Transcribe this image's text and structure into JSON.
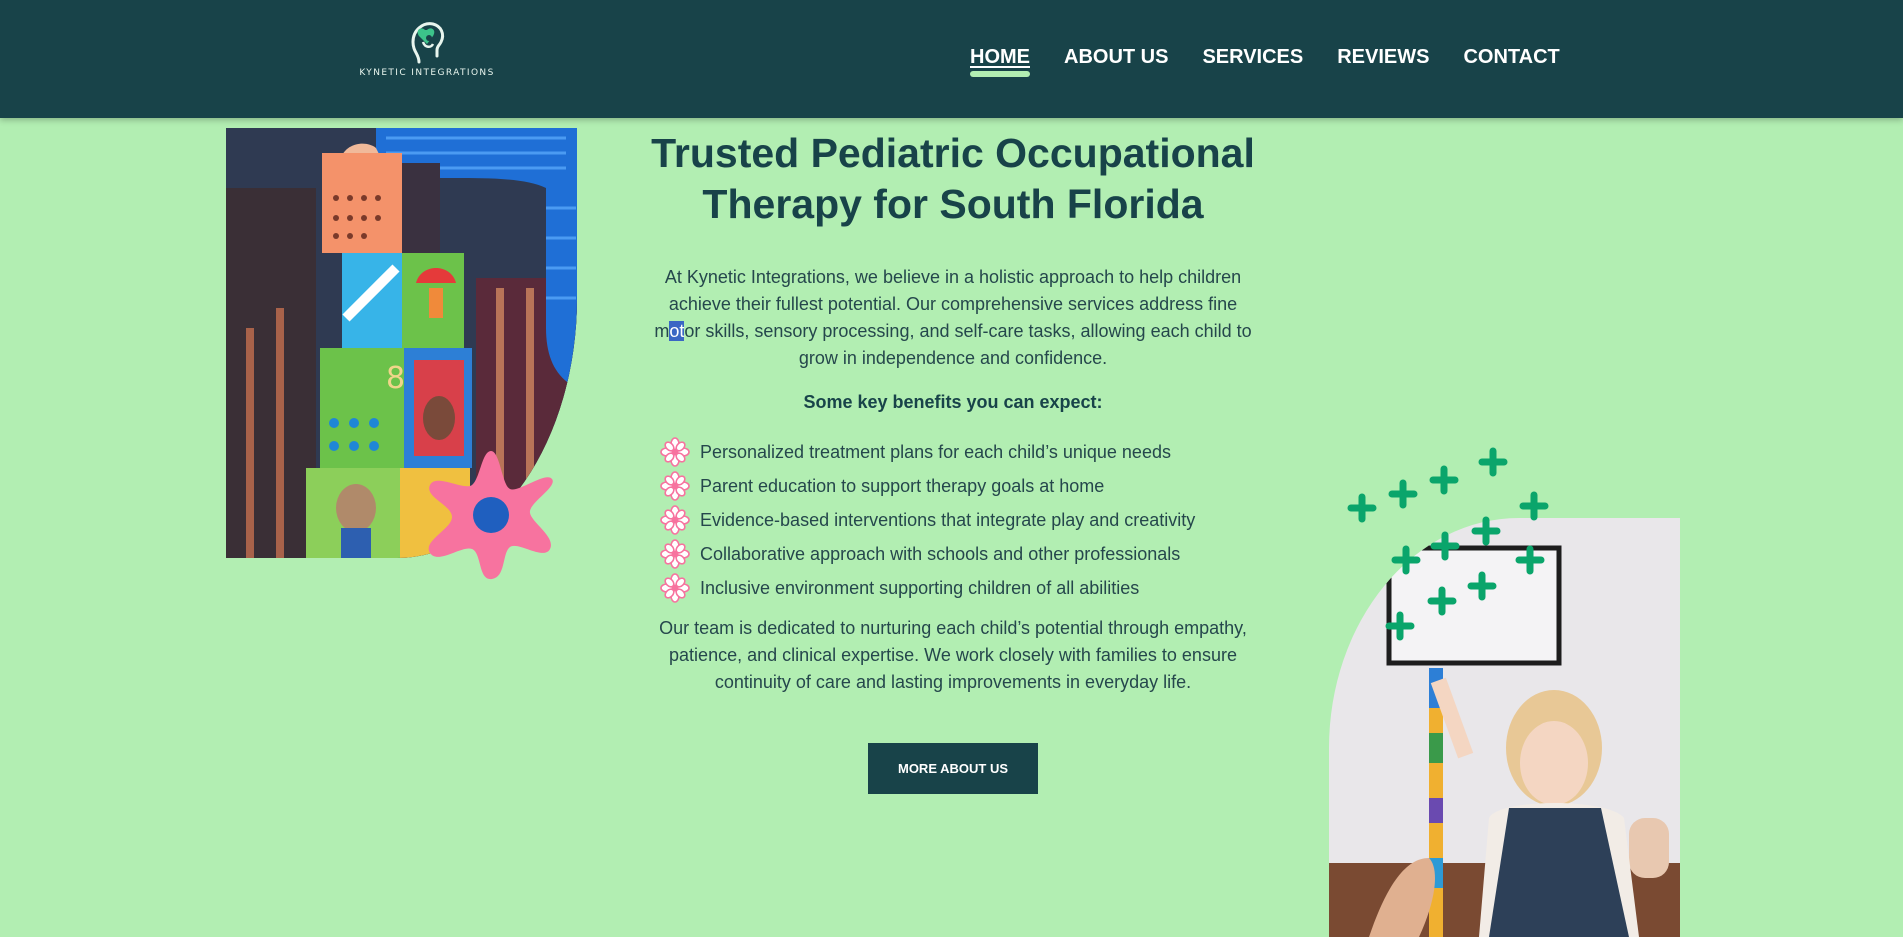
{
  "header": {
    "logo_text": "KYNETIC INTEGRATIONS",
    "nav": [
      {
        "label": "HOME",
        "active": true
      },
      {
        "label": "ABOUT US",
        "active": false
      },
      {
        "label": "SERVICES",
        "active": false
      },
      {
        "label": "REVIEWS",
        "active": false
      },
      {
        "label": "CONTACT",
        "active": false
      }
    ]
  },
  "hero": {
    "title_line1": "Trusted Pediatric Occupational",
    "title_line2": "Therapy for South Florida",
    "intro_part1": "At Kynetic Integrations, we believe in a holistic approach to help children achieve their fullest potential. Our comprehensive services address fine m",
    "intro_selected": "ot",
    "intro_part2": "or skills, sensory processing, and self-care tasks, allowing each child to grow in independence and confidence.",
    "benefits_heading": "Some key benefits you can expect:",
    "benefits": [
      "Personalized treatment plans for each child’s unique needs",
      "Parent education to support therapy goals at home",
      "Evidence-based interventions that integrate play and creativity",
      "Collaborative approach with schools and other professionals",
      "Inclusive environment supporting children of all abilities"
    ],
    "outro": "Our team is dedicated to nurturing each child’s potential through empathy, patience, and clinical expertise. We work closely with families to ensure continuity of care and lasting improvements in everyday life.",
    "cta_label": "MORE ABOUT US"
  },
  "icons": {
    "logo": "head-heart-logo-icon",
    "bullet": "flower-bullet-icon",
    "flower_decoration": "pink-flower-icon",
    "crosses_decoration": "green-plus-pattern-icon"
  },
  "colors": {
    "background": "#b2eeb2",
    "header": "#184349",
    "text": "#184349",
    "accent_pink": "#f7739f",
    "accent_blue": "#1f5fbf",
    "accent_green": "#0aa56b"
  }
}
